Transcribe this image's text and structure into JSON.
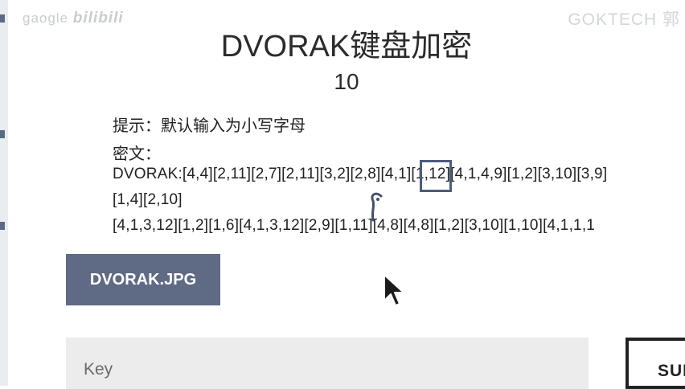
{
  "watermarks": {
    "left_prefix": "gaogle",
    "left_brand": "bilibili",
    "right": "GOKTECH 郭"
  },
  "challenge": {
    "title": "DVORAK键盘加密",
    "points": "10",
    "hint": "提示：默认输入为小写字母",
    "cipher_label": "密文：",
    "cipher_lines": [
      "DVORAK:[4,4][2,11][2,7][2,11][3,2][2,8][4,1][1,12][4,1,4,9][1,2][3,10][3,9]",
      "[1,4][2,10]",
      "[4,1,3,12][1,2][1,6][4,1,3,12][2,9][1,11][4,8][4,8][1,2][3,10][1,10][4,1,1,1"
    ],
    "attachment_label": "DVORAK.JPG",
    "key_placeholder": "Key",
    "submit_label": "SUB"
  },
  "colors": {
    "button_bg": "#5f6a84",
    "input_bg": "#ececec",
    "highlight": "#4e5c7c"
  },
  "icons": {
    "cursor": "mouse-pointer-icon",
    "annotation": "pen-scribble-icon"
  }
}
